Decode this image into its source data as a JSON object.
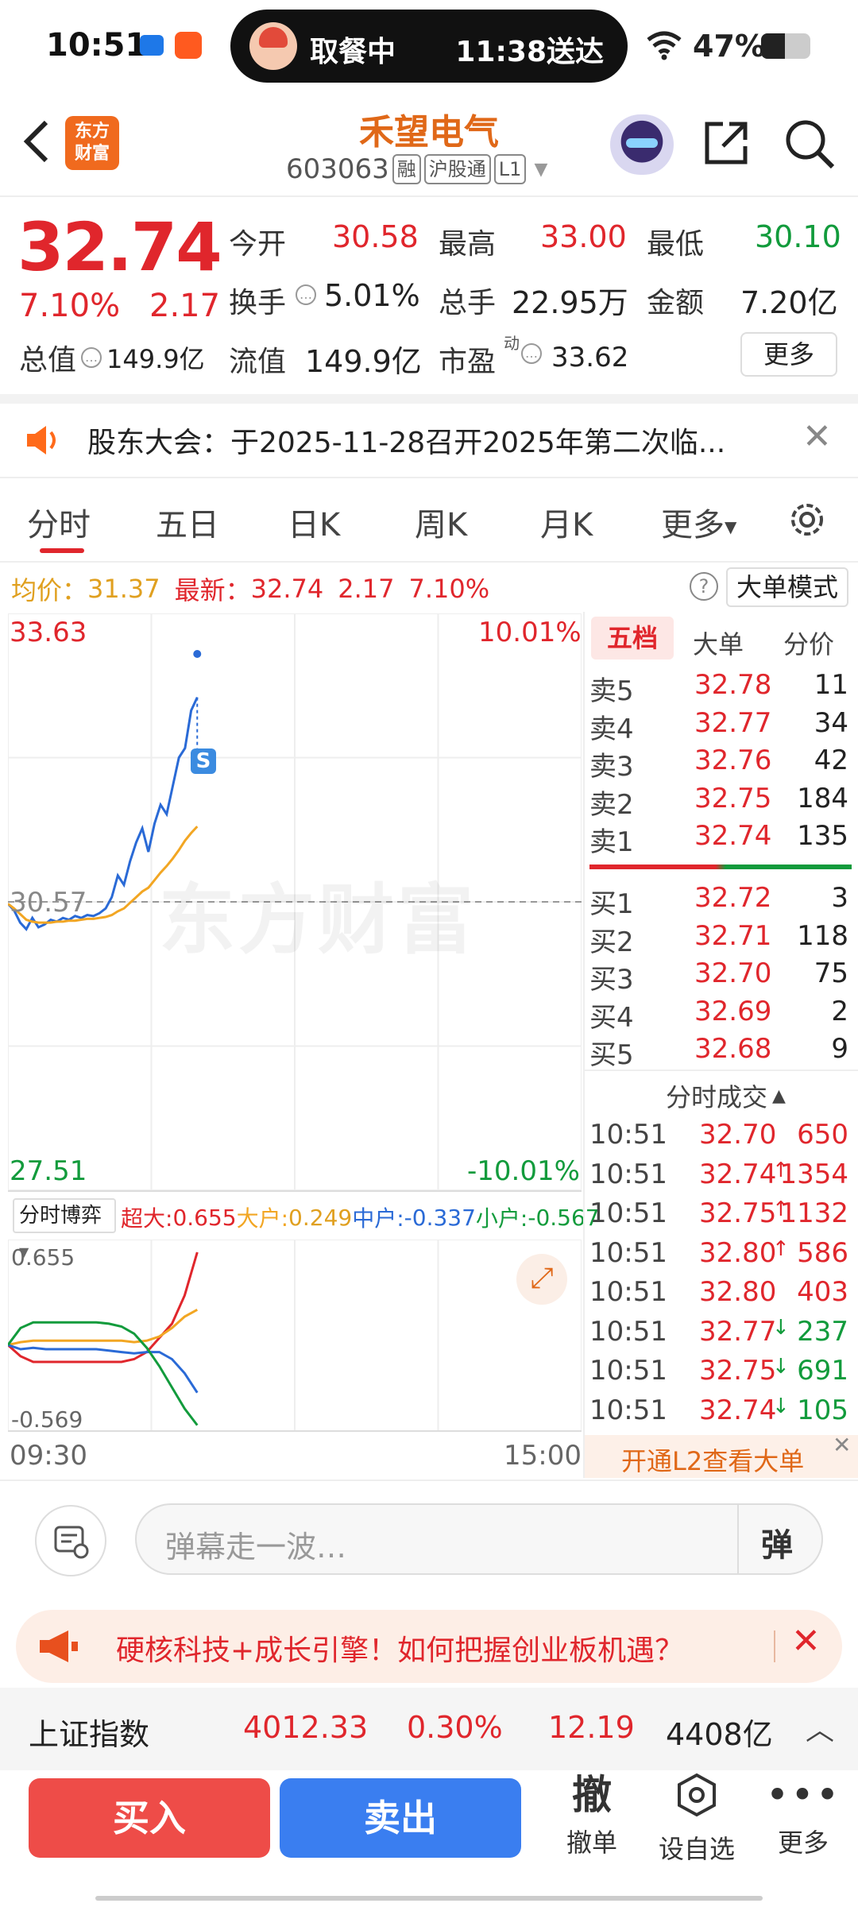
{
  "status_bar": {
    "time": "10:51",
    "island_left": "取餐中",
    "island_right": "11:38送达",
    "battery": "47%"
  },
  "header": {
    "logo": "东方\n财富",
    "stock_name": "禾望电气",
    "stock_code": "603063",
    "tags": [
      "融",
      "沪股通",
      "L1"
    ]
  },
  "quote": {
    "price": "32.74",
    "change_pct": "7.10%",
    "change": "2.17",
    "open_label": "今开",
    "open": "30.58",
    "high_label": "最高",
    "high": "33.00",
    "low_label": "最低",
    "low": "30.10",
    "turnover_label": "换手",
    "turnover": "5.01%",
    "volume_label": "总手",
    "volume": "22.95万",
    "amount_label": "金额",
    "amount": "7.20亿",
    "total_mv_label": "总值",
    "total_mv": "149.9亿",
    "float_mv_label": "流值",
    "float_mv": "149.9亿",
    "pe_label": "市盈",
    "pe_sup": "动",
    "pe": "33.62",
    "more_button": "更多"
  },
  "notice": {
    "text": "股东大会：于2025-11-28召开2025年第二次临..."
  },
  "tabs": [
    "分时",
    "五日",
    "日K",
    "周K",
    "月K",
    "更多"
  ],
  "chart_header": {
    "avg_label": "均价：",
    "avg": "31.37",
    "latest_label": "最新：",
    "latest": "32.74",
    "chg": "2.17",
    "chg_pct": "7.10%",
    "mode_button": "大单模式"
  },
  "chart_data": {
    "type": "line",
    "title": "",
    "y_max_label": "33.63",
    "y_min_label": "27.51",
    "y_mid_label": "30.57",
    "pct_max_label": "10.01%",
    "pct_min_label": "-10.01%",
    "x_start_label": "09:30",
    "x_end_label": "15:00",
    "ylim": [
      27.51,
      33.63
    ],
    "prev_close": 30.57,
    "series": [
      {
        "values": [
          30.55,
          30.48,
          30.35,
          30.28,
          30.4,
          30.3,
          30.33,
          30.38,
          30.36,
          30.4,
          30.38,
          30.42,
          30.4,
          30.43,
          30.42,
          30.45,
          30.5,
          30.62,
          30.85,
          30.75,
          31.0,
          31.2,
          31.35,
          31.1,
          31.4,
          31.6,
          31.5,
          31.8,
          32.1,
          32.2,
          32.6,
          32.74
        ],
        "color": "#2a6ad6"
      },
      {
        "values": [
          30.55,
          30.5,
          30.44,
          30.38,
          30.36,
          30.35,
          30.35,
          30.35,
          30.36,
          30.36,
          30.37,
          30.37,
          30.38,
          30.39,
          30.39,
          30.4,
          30.41,
          30.43,
          30.47,
          30.5,
          30.56,
          30.62,
          30.68,
          30.72,
          30.8,
          30.88,
          30.95,
          31.03,
          31.12,
          31.22,
          31.3,
          31.37
        ],
        "color": "#f2a623"
      }
    ],
    "marker_label": "S",
    "watermark": "东方财富"
  },
  "capital_flow": {
    "selector": "分时博弈",
    "super_label": "超大:",
    "super": "0.655",
    "large_label": "大户:",
    "large": "0.249",
    "medium_label": "中户:",
    "medium": "-0.337",
    "small_label": "小户:",
    "small": "-0.567",
    "y_max": "0.655",
    "y_min": "-0.569",
    "chart_data": {
      "type": "line",
      "ylim": [
        -0.569,
        0.655
      ],
      "series": [
        {
          "values": [
            0.0,
            -0.08,
            -0.12,
            -0.12,
            -0.12,
            -0.12,
            -0.12,
            -0.12,
            -0.12,
            -0.12,
            -0.1,
            -0.05,
            0.05,
            0.15,
            0.35,
            0.655
          ],
          "color": "#e0262c"
        },
        {
          "values": [
            0.0,
            0.02,
            0.03,
            0.03,
            0.03,
            0.03,
            0.03,
            0.03,
            0.03,
            0.03,
            0.02,
            0.03,
            0.06,
            0.12,
            0.2,
            0.249
          ],
          "color": "#f2a623"
        },
        {
          "values": [
            0.0,
            -0.03,
            -0.02,
            -0.03,
            -0.03,
            -0.03,
            -0.03,
            -0.03,
            -0.04,
            -0.05,
            -0.06,
            -0.05,
            -0.05,
            -0.1,
            -0.2,
            -0.337
          ],
          "color": "#2a6ad6"
        },
        {
          "values": [
            0.0,
            0.12,
            0.16,
            0.16,
            0.16,
            0.16,
            0.16,
            0.16,
            0.15,
            0.13,
            0.08,
            -0.02,
            -0.15,
            -0.3,
            -0.45,
            -0.567
          ],
          "color": "#129b3c"
        }
      ]
    }
  },
  "order_book": {
    "tabs": [
      "五档",
      "大单",
      "分价"
    ],
    "asks": [
      {
        "label": "卖5",
        "price": "32.78",
        "vol": "11"
      },
      {
        "label": "卖4",
        "price": "32.77",
        "vol": "34"
      },
      {
        "label": "卖3",
        "price": "32.76",
        "vol": "42"
      },
      {
        "label": "卖2",
        "price": "32.75",
        "vol": "184"
      },
      {
        "label": "卖1",
        "price": "32.74",
        "vol": "135"
      }
    ],
    "bids": [
      {
        "label": "买1",
        "price": "32.72",
        "vol": "3"
      },
      {
        "label": "买2",
        "price": "32.71",
        "vol": "118"
      },
      {
        "label": "买3",
        "price": "32.70",
        "vol": "75"
      },
      {
        "label": "买4",
        "price": "32.69",
        "vol": "2"
      },
      {
        "label": "买5",
        "price": "32.68",
        "vol": "9"
      }
    ]
  },
  "trades": {
    "title": "分时成交",
    "rows": [
      {
        "time": "10:51",
        "price": "32.70",
        "arrow": "",
        "vol": "650",
        "dir": "red"
      },
      {
        "time": "10:51",
        "price": "32.74",
        "arrow": "↑",
        "vol": "1354",
        "dir": "red"
      },
      {
        "time": "10:51",
        "price": "32.75",
        "arrow": "↑",
        "vol": "1132",
        "dir": "red"
      },
      {
        "time": "10:51",
        "price": "32.80",
        "arrow": "↑",
        "vol": "586",
        "dir": "red"
      },
      {
        "time": "10:51",
        "price": "32.80",
        "arrow": "",
        "vol": "403",
        "dir": "red"
      },
      {
        "time": "10:51",
        "price": "32.77",
        "arrow": "↓",
        "vol": "237",
        "dir": "green"
      },
      {
        "time": "10:51",
        "price": "32.75",
        "arrow": "↓",
        "vol": "691",
        "dir": "green"
      },
      {
        "time": "10:51",
        "price": "32.74",
        "arrow": "↓",
        "vol": "105",
        "dir": "green"
      }
    ],
    "l2_banner": "开通L2查看大单"
  },
  "danmu": {
    "placeholder": "弹幕走一波…",
    "button": "弹"
  },
  "promo": {
    "text": "硬核科技+成长引擎！如何把握创业板机遇？"
  },
  "index_bar": {
    "name": "上证指数",
    "value": "4012.33",
    "pct": "0.30%",
    "chg": "12.19",
    "amount": "4408亿"
  },
  "bottom": {
    "buy": "买入",
    "sell": "卖出",
    "cancel_icon_char": "撤",
    "cancel": "撤单",
    "watchlist": "设自选",
    "more": "更多"
  }
}
